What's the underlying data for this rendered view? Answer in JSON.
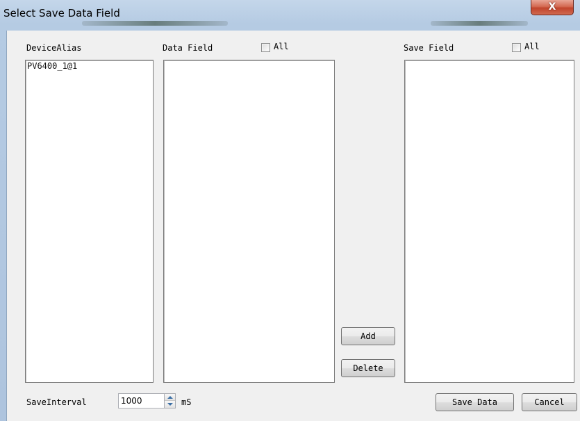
{
  "window": {
    "title": "Select Save Data Field",
    "close_icon": "X"
  },
  "device_panel": {
    "header": "DeviceAlias",
    "items": [
      "PV6400_1@1"
    ]
  },
  "data_field_panel": {
    "header": "Data Field",
    "all_label": "All",
    "all_checked": false,
    "items": []
  },
  "save_field_panel": {
    "header": "Save Field",
    "all_label": "All",
    "all_checked": false,
    "items": []
  },
  "buttons": {
    "add": "Add",
    "delete": "Delete",
    "save_data": "Save Data",
    "cancel": "Cancel"
  },
  "interval": {
    "label": "SaveInterval",
    "value": "1000",
    "unit": "mS"
  },
  "icons": {
    "close": "close-icon",
    "spin_up": "chevron-up-icon",
    "spin_down": "chevron-down-icon"
  }
}
